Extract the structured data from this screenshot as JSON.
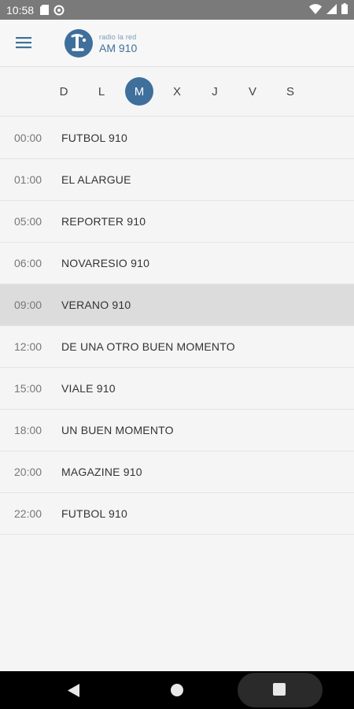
{
  "status": {
    "time": "10:58"
  },
  "app": {
    "logo_small": "radio la red",
    "logo_big": "AM 910"
  },
  "days": [
    {
      "label": "D"
    },
    {
      "label": "L"
    },
    {
      "label": "M",
      "selected": true
    },
    {
      "label": "X"
    },
    {
      "label": "J"
    },
    {
      "label": "V"
    },
    {
      "label": "S"
    }
  ],
  "schedule": [
    {
      "time": "00:00",
      "program": "FUTBOL 910"
    },
    {
      "time": "01:00",
      "program": "EL ALARGUE"
    },
    {
      "time": "05:00",
      "program": "REPORTER 910"
    },
    {
      "time": "06:00",
      "program": "NOVARESIO 910"
    },
    {
      "time": "09:00",
      "program": "VERANO 910",
      "active": true
    },
    {
      "time": "12:00",
      "program": "DE UNA OTRO BUEN MOMENTO"
    },
    {
      "time": "15:00",
      "program": "VIALE 910"
    },
    {
      "time": "18:00",
      "program": "UN BUEN MOMENTO"
    },
    {
      "time": "20:00",
      "program": "MAGAZINE 910"
    },
    {
      "time": "22:00",
      "program": "FUTBOL 910"
    }
  ],
  "colors": {
    "accent": "#3f6f9b",
    "active_row": "#dcdcdc"
  },
  "icons": {
    "status_left": [
      "sd-card-icon",
      "at-sign-icon"
    ],
    "status_right": [
      "wifi-icon",
      "cellular-signal-icon",
      "battery-icon"
    ],
    "appbar": [
      "hamburger-menu-icon",
      "radio-la-red-logo"
    ],
    "navigation": [
      "back-triangle-icon",
      "home-circle-icon",
      "recents-square-icon"
    ]
  }
}
